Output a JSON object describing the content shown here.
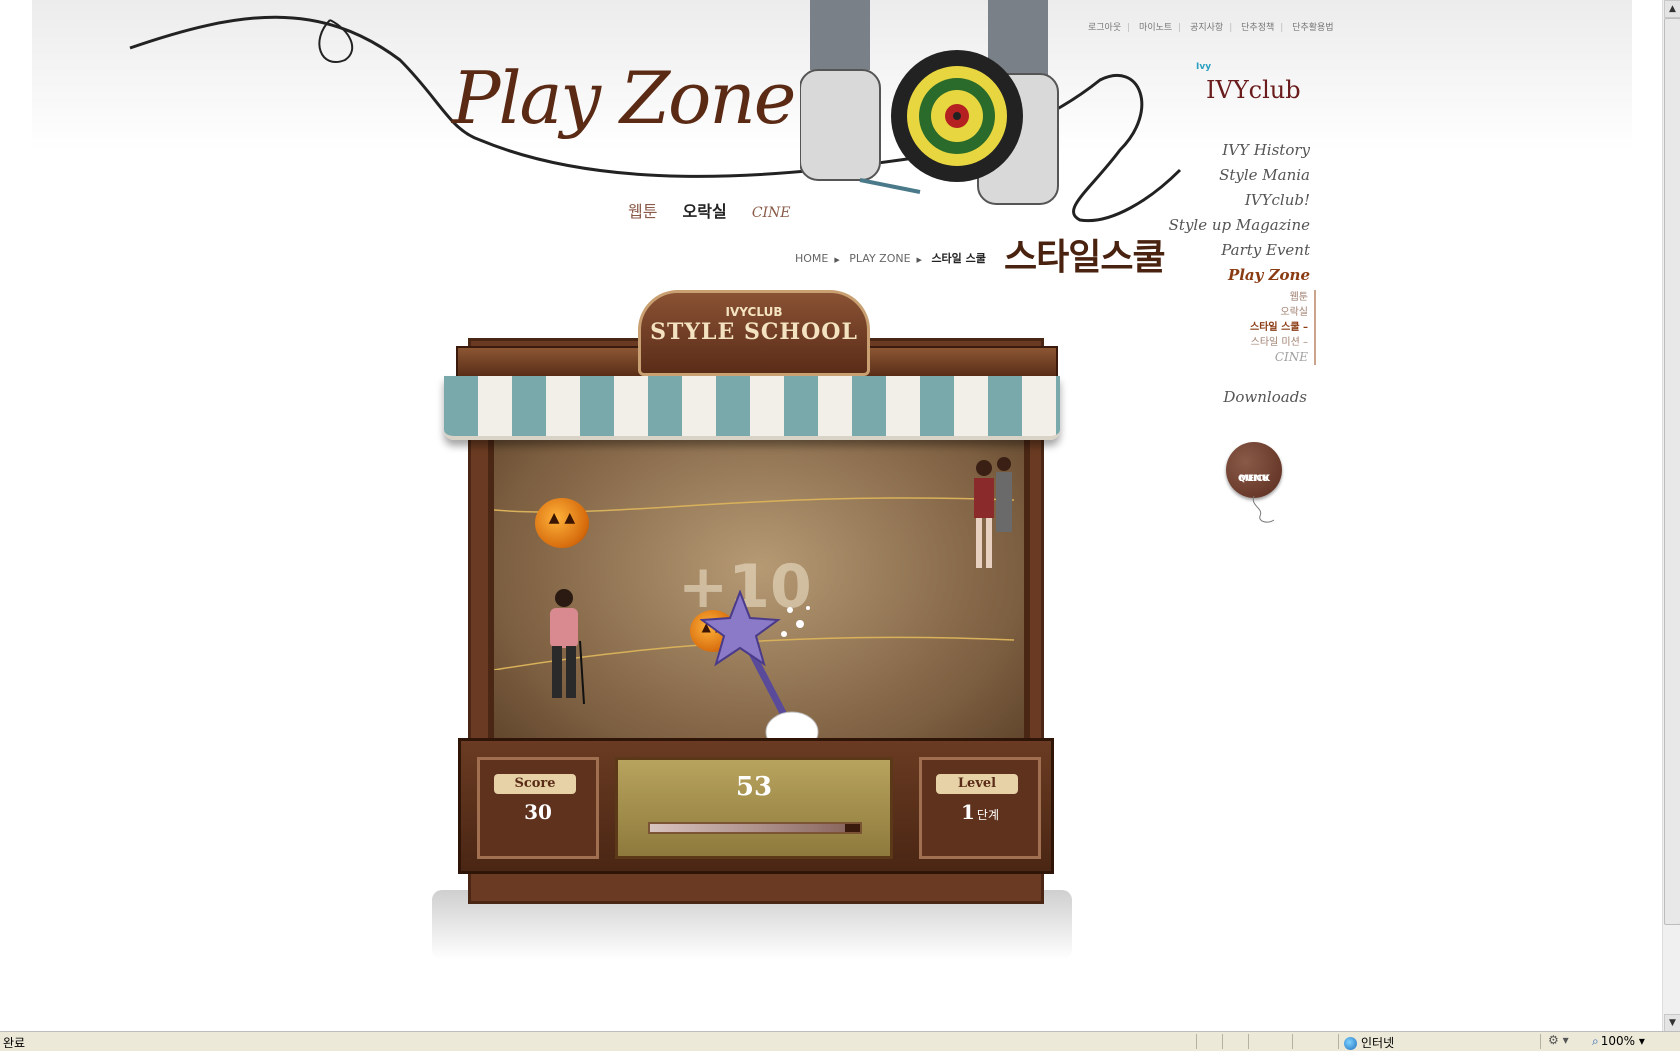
{
  "top_links": [
    "로그아웃",
    "마이노트",
    "공지사항",
    "단추정책",
    "단추활용법"
  ],
  "logo": {
    "mark": "Ivy",
    "text": "IVYclub"
  },
  "nav": {
    "items": [
      "IVY History",
      "Style Mania",
      "IVYclub!",
      "Style up Magazine",
      "Party Event",
      "Play Zone"
    ],
    "active": "Play Zone",
    "sub_items": [
      "웹툰",
      "오락실",
      "스타일 스쿨 –",
      "스타일 미션 –",
      "CINE"
    ],
    "downloads": "Downloads"
  },
  "quick_menu": {
    "line1": "QUICK",
    "line2": "MENU"
  },
  "header": {
    "title": "Play Zone",
    "sub_links": [
      "웹툰",
      "오락실",
      "CINE"
    ]
  },
  "breadcrumb": {
    "home": "HOME",
    "section": "PLAY ZONE",
    "current": "스타일 스쿨"
  },
  "page_heading": "스타일스쿨",
  "game": {
    "sign_top": "IVYCLUB",
    "sign_title": "STYLE SCHOOL",
    "bonus_text": "+10",
    "score_label": "Score",
    "score_value": "30",
    "timer_value": "53",
    "timer_progress": 0.93,
    "level_label": "Level",
    "level_value": "1",
    "level_unit": "단계"
  },
  "statusbar": {
    "status": "완료",
    "zone": "인터넷",
    "zoom": "100%"
  },
  "colors": {
    "brand": "#6a1c1c",
    "accent": "#8a3b12",
    "awning_stripe": "#7aa9ab"
  }
}
